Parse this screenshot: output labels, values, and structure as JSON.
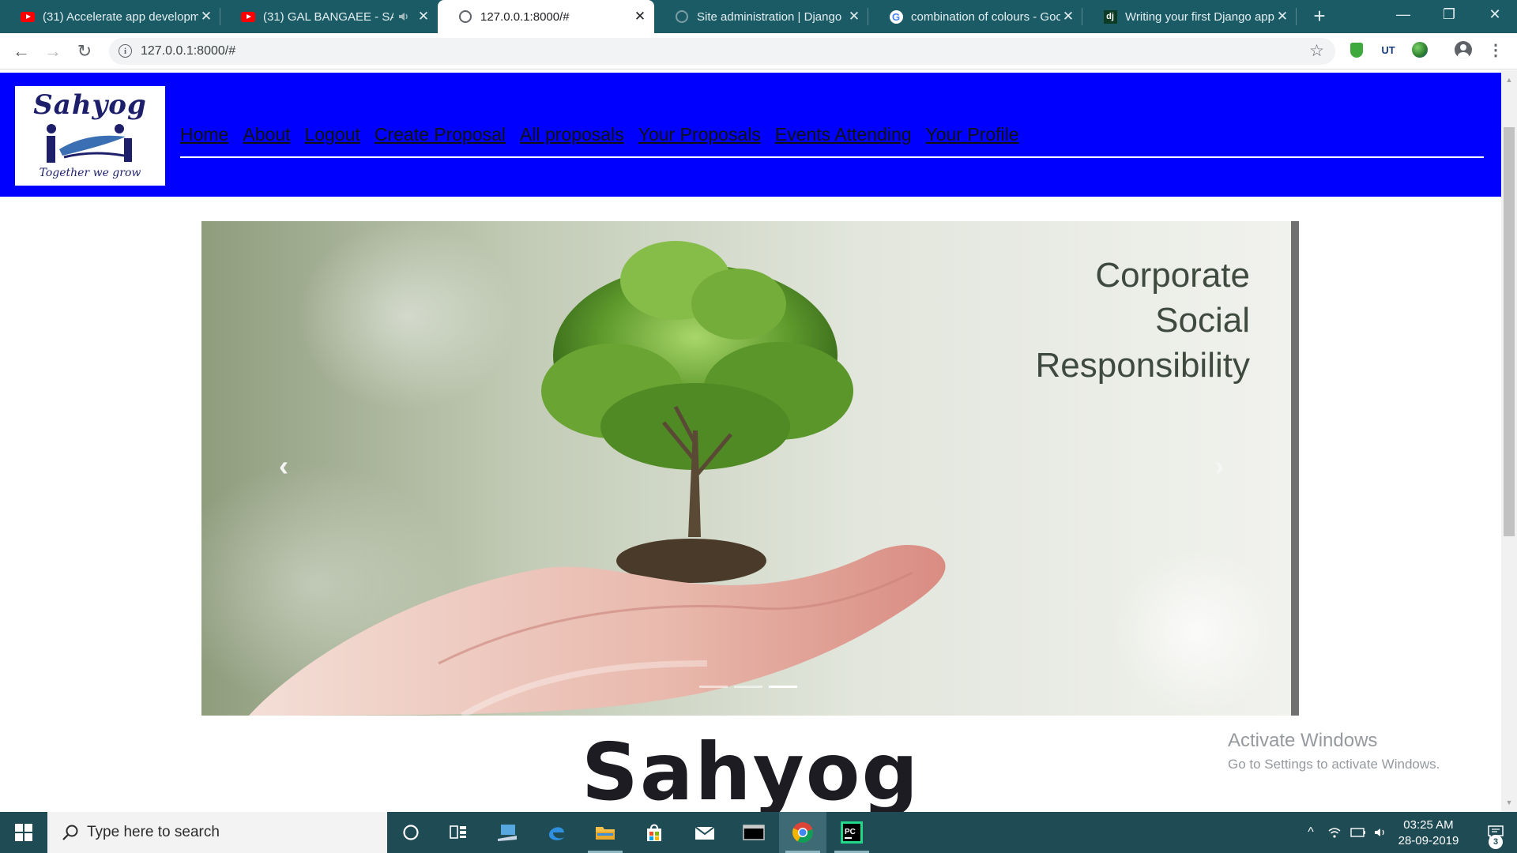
{
  "browser": {
    "tabs": [
      {
        "title": "(31) Accelerate app developm",
        "icon": "youtube-icon",
        "active": false
      },
      {
        "title": "(31) GAL BANGAEE - SAH",
        "icon": "youtube-icon",
        "active": false,
        "audio": true
      },
      {
        "title": "127.0.0.1:8000/#",
        "icon": "globe-icon",
        "active": true
      },
      {
        "title": "Site administration | Django",
        "icon": "globe-icon",
        "active": false
      },
      {
        "title": "combination of colours - Goo",
        "icon": "google-icon",
        "active": false
      },
      {
        "title": "Writing your first Django app",
        "icon": "django-icon",
        "active": false
      }
    ],
    "google_icon_glyph": "G",
    "django_icon_glyph": "dj",
    "new_tab_glyph": "+",
    "window_controls": {
      "minimize": "—",
      "restore": "❐",
      "close": "✕"
    },
    "close_glyph": "✕",
    "nav": {
      "back": "←",
      "forward": "→",
      "reload": "↻"
    },
    "address_info_glyph": "i",
    "address": "127.0.0.1:8000/#",
    "bookmark_glyph": "☆",
    "extensions": {
      "ut_label": "UT",
      "menu_glyph": "⋮"
    }
  },
  "site": {
    "logo": {
      "word": "Sahyog",
      "tagline": "Together we grow"
    },
    "nav_links": [
      "Home",
      "About",
      "Logout",
      "Create Proposal",
      "All proposals",
      "Your Proposals",
      "Events Attending",
      "Your Profile"
    ],
    "carousel": {
      "caption_lines": [
        "Corporate",
        "Social",
        "Responsibility"
      ],
      "prev_glyph": "‹",
      "next_glyph": "›",
      "slide_count": 3,
      "active_slide": 2
    },
    "hero_title": "Sahyog",
    "colors": {
      "nav_background": "#0000ff",
      "nav_link": "#111111",
      "title": "#1c1c22"
    }
  },
  "watermark": {
    "title": "Activate Windows",
    "subtitle": "Go to Settings to activate Windows."
  },
  "taskbar": {
    "search_placeholder": "Type here to search",
    "apps": [
      "cortana-icon",
      "task-view-icon",
      "network-app-icon",
      "edge-icon",
      "file-explorer-icon",
      "store-icon",
      "mail-icon",
      "terminal-icon",
      "chrome-icon",
      "pycharm-icon"
    ],
    "pycharm_label": "PC",
    "tray": {
      "chevron": "^"
    },
    "time": "03:25 AM",
    "date": "28-09-2019",
    "notification_count": "3"
  }
}
